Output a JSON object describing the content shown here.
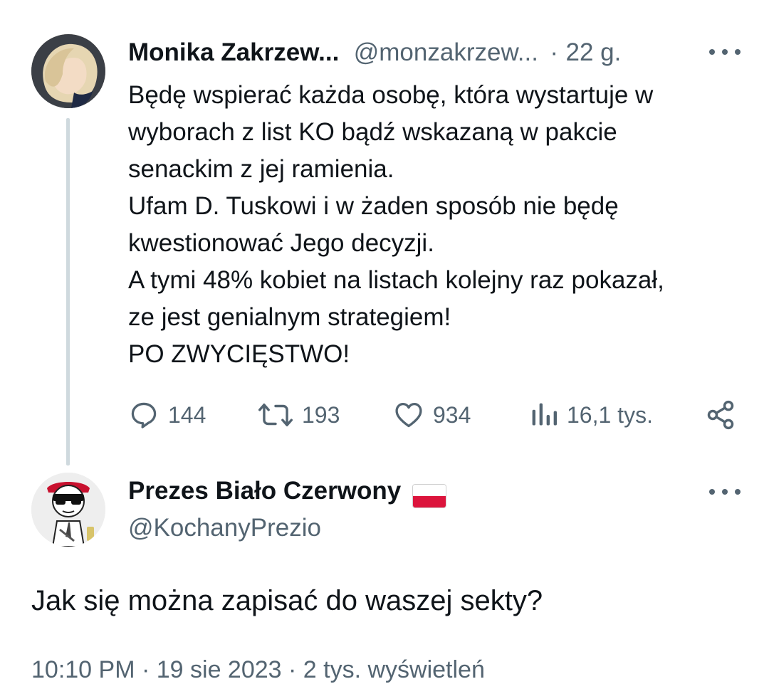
{
  "parent_tweet": {
    "author_name": "Monika Zakrzew...",
    "handle": "@monzakrzew...",
    "separator": "·",
    "time": "22 g.",
    "text_lines": [
      "Będę wspierać każda osobę, która wystartuje w",
      "wyborach z list KO bądź wskazaną w pakcie",
      "senackim z jej ramienia.",
      "Ufam D. Tuskowi i w żaden sposób nie będę",
      "kwestionować Jego decyzji.",
      "A tymi 48% kobiet na listach kolejny raz pokazał,",
      "ze jest genialnym strategiem!",
      "PO ZWYCIĘSTWO!"
    ],
    "actions": {
      "replies": "144",
      "retweets": "193",
      "likes": "934",
      "views": "16,1 tys."
    }
  },
  "reply_tweet": {
    "author_name": "Prezes Biało Czerwony",
    "handle": "@KochanyPrezio",
    "text": "Jak się można zapisać do waszej sekty?",
    "footer": "10:10 PM · 19 sie 2023 · 2 tys. wyświetleń"
  },
  "colors": {
    "text": "#0f1419",
    "muted": "#536471",
    "thread_line": "#cfd9de",
    "flag_red": "#dc143c"
  },
  "icons": [
    "reply-icon",
    "retweet-icon",
    "like-icon",
    "views-icon",
    "share-icon",
    "more-icon",
    "poland-flag-icon"
  ]
}
